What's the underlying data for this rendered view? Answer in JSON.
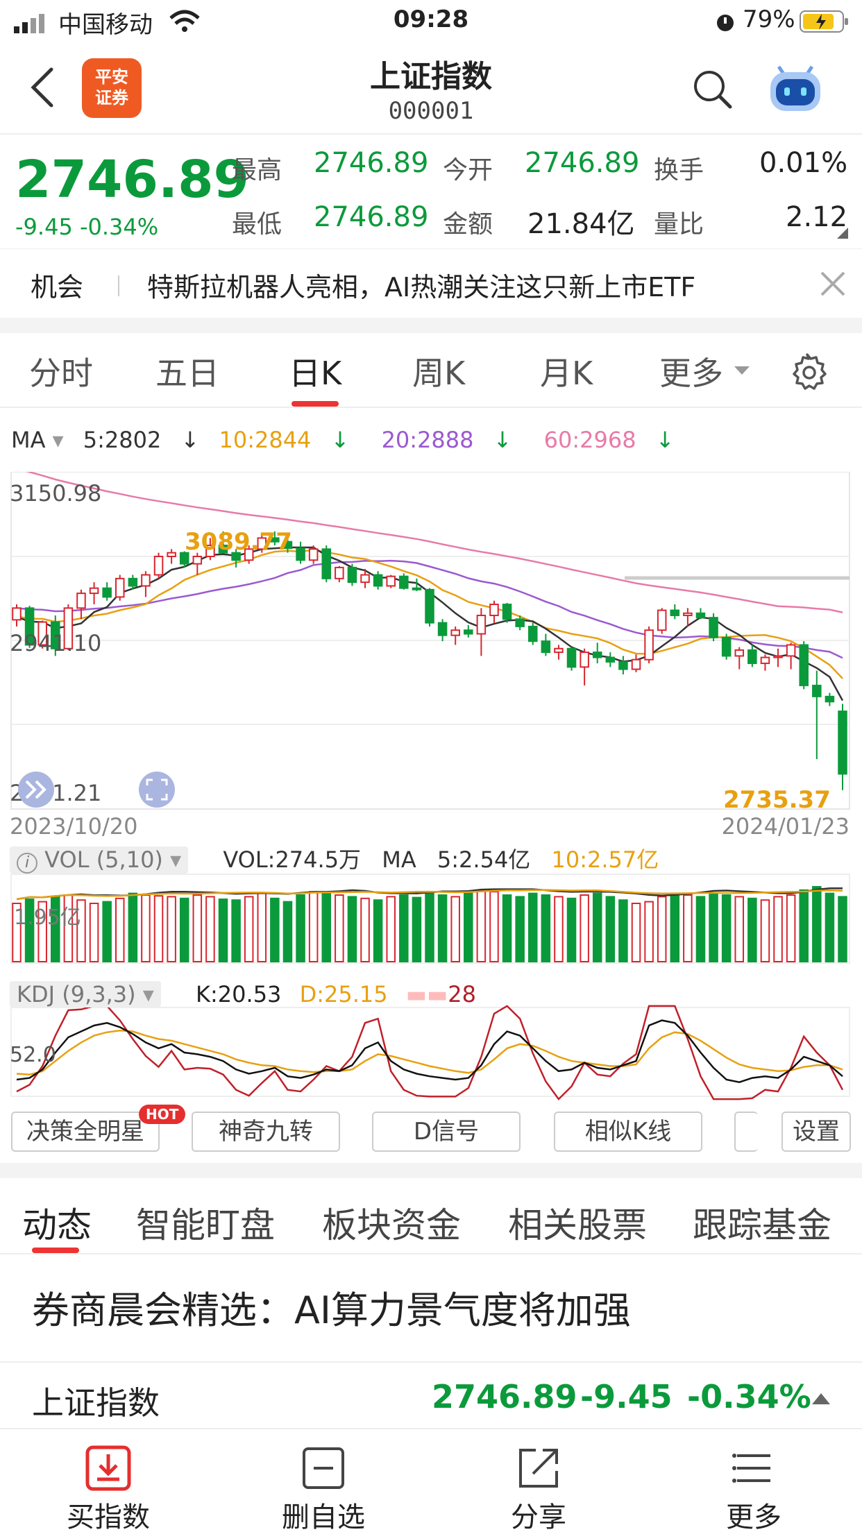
{
  "status_bar": {
    "carrier": "中国移动",
    "time": "09:28",
    "battery": "79%"
  },
  "nav": {
    "logo_line1": "平安",
    "logo_line2": "证券",
    "title": "上证指数",
    "code": "000001"
  },
  "quote": {
    "price": "2746.89",
    "change": "-9.45 -0.34%",
    "stats": [
      {
        "label": "最高",
        "value": "2746.89",
        "color": "green"
      },
      {
        "label": "今开",
        "value": "2746.89",
        "color": "green"
      },
      {
        "label": "换手",
        "value": "0.01%",
        "color": "black"
      },
      {
        "label": "最低",
        "value": "2746.89",
        "color": "green"
      },
      {
        "label": "金额",
        "value": "21.84亿",
        "color": "black"
      },
      {
        "label": "量比",
        "value": "2.12",
        "color": "black"
      }
    ]
  },
  "ticker": {
    "label": "机会",
    "text": "特斯拉机器人亮相，AI热潮关注这只新上市ETF"
  },
  "kline_tabs": [
    "分时",
    "五日",
    "日K",
    "周K",
    "月K",
    "更多"
  ],
  "active_kline_tab": "日K",
  "ma_legend": {
    "label": "MA",
    "ma5": "5:2802",
    "ma10": "10:2844",
    "ma20": "20:2888",
    "ma60": "60:2968"
  },
  "price_axis": {
    "top": "3150.98",
    "mid": "2941.10",
    "low": "2731.21",
    "start_date": "2023/10/20",
    "end_date": "2024/01/23",
    "high_mark": "3089.77",
    "low_mark": "2735.37"
  },
  "volume_legend": {
    "label": "VOL (5,10)",
    "vol": "VOL:274.5万",
    "ma_label": "MA",
    "ma5": "5:2.54亿",
    "ma10": "10:2.57亿",
    "axis": "1.95亿"
  },
  "kdj_legend": {
    "label": "KDJ (9,3,3)",
    "k": "K:20.53",
    "d": "D:25.15",
    "j_tail": "28",
    "axis": "52.0"
  },
  "tools": [
    "决策全明星",
    "神奇九转",
    "D信号",
    "相似K线",
    "设置"
  ],
  "hot_badge": "HOT",
  "info_tabs": [
    "动态",
    "智能盯盘",
    "板块资金",
    "相关股票",
    "跟踪基金"
  ],
  "headline": "券商晨会精选：AI算力景气度将加强",
  "index_row": {
    "name": "上证指数",
    "price": "2746.89",
    "change": "-9.45",
    "pct": "-0.34%"
  },
  "bottom_bar": [
    {
      "label": "买指数",
      "icon": "download-icon"
    },
    {
      "label": "删自选",
      "icon": "minus-box-icon"
    },
    {
      "label": "分享",
      "icon": "share-icon"
    },
    {
      "label": "更多",
      "icon": "list-icon"
    }
  ],
  "colors": {
    "up": "#d8262e",
    "down": "#0b9a3b",
    "ma5": "#333333",
    "ma10": "#e8a010",
    "ma20": "#9b59d0",
    "ma60": "#e77aa8",
    "accent": "#e33333"
  },
  "chart_data": {
    "type": "candlestick",
    "price_range": [
      2731.21,
      3150.98
    ],
    "candles": [
      [
        2969,
        2990,
        2960,
        2985
      ],
      [
        2985,
        2988,
        2931,
        2935
      ],
      [
        2935,
        2968,
        2930,
        2966
      ],
      [
        2966,
        2975,
        2920,
        2930
      ],
      [
        2930,
        2990,
        2928,
        2985
      ],
      [
        2985,
        3010,
        2970,
        3005
      ],
      [
        3005,
        3020,
        2990,
        3012
      ],
      [
        3012,
        3020,
        2995,
        3000
      ],
      [
        3000,
        3030,
        2995,
        3025
      ],
      [
        3025,
        3030,
        3010,
        3015
      ],
      [
        3015,
        3035,
        3000,
        3030
      ],
      [
        3030,
        3060,
        3025,
        3055
      ],
      [
        3055,
        3065,
        3045,
        3060
      ],
      [
        3060,
        3062,
        3040,
        3045
      ],
      [
        3045,
        3060,
        3030,
        3055
      ],
      [
        3055,
        3080,
        3050,
        3070
      ],
      [
        3070,
        3089,
        3060,
        3060
      ],
      [
        3060,
        3065,
        3040,
        3050
      ],
      [
        3050,
        3070,
        3045,
        3065
      ],
      [
        3065,
        3085,
        3060,
        3080
      ],
      [
        3080,
        3089,
        3070,
        3075
      ],
      [
        3075,
        3082,
        3060,
        3066
      ],
      [
        3066,
        3075,
        3045,
        3050
      ],
      [
        3050,
        3070,
        3045,
        3065
      ],
      [
        3065,
        3070,
        3020,
        3025
      ],
      [
        3025,
        3042,
        3020,
        3040
      ],
      [
        3040,
        3045,
        3015,
        3020
      ],
      [
        3020,
        3038,
        3012,
        3030
      ],
      [
        3030,
        3035,
        3010,
        3015
      ],
      [
        3015,
        3030,
        3012,
        3028
      ],
      [
        3028,
        3032,
        3010,
        3012
      ],
      [
        3012,
        3025,
        3008,
        3010
      ],
      [
        3010,
        3012,
        2960,
        2965
      ],
      [
        2965,
        2970,
        2940,
        2948
      ],
      [
        2948,
        2960,
        2935,
        2955
      ],
      [
        2955,
        2962,
        2945,
        2950
      ],
      [
        2950,
        2985,
        2920,
        2975
      ],
      [
        2975,
        2995,
        2965,
        2990
      ],
      [
        2990,
        2992,
        2965,
        2970
      ],
      [
        2970,
        2975,
        2955,
        2960
      ],
      [
        2960,
        2965,
        2935,
        2940
      ],
      [
        2940,
        2950,
        2920,
        2925
      ],
      [
        2925,
        2935,
        2915,
        2930
      ],
      [
        2930,
        2932,
        2900,
        2905
      ],
      [
        2905,
        2930,
        2880,
        2925
      ],
      [
        2925,
        2938,
        2910,
        2918
      ],
      [
        2918,
        2925,
        2905,
        2912
      ],
      [
        2912,
        2920,
        2895,
        2902
      ],
      [
        2902,
        2922,
        2898,
        2915
      ],
      [
        2915,
        2960,
        2910,
        2955
      ],
      [
        2955,
        2985,
        2950,
        2982
      ],
      [
        2982,
        2990,
        2970,
        2975
      ],
      [
        2975,
        2985,
        2960,
        2978
      ],
      [
        2978,
        2985,
        2970,
        2972
      ],
      [
        2972,
        2978,
        2940,
        2945
      ],
      [
        2945,
        2950,
        2915,
        2920
      ],
      [
        2920,
        2932,
        2902,
        2928
      ],
      [
        2928,
        2935,
        2905,
        2910
      ],
      [
        2910,
        2922,
        2900,
        2918
      ],
      [
        2918,
        2930,
        2905,
        2920
      ],
      [
        2920,
        2938,
        2902,
        2935
      ],
      [
        2935,
        2940,
        2875,
        2880
      ],
      [
        2880,
        2900,
        2780,
        2865
      ],
      [
        2865,
        2870,
        2852,
        2858
      ],
      [
        2845,
        2855,
        2738,
        2760
      ]
    ],
    "volume": [
      0.7,
      0.75,
      0.72,
      0.78,
      0.8,
      0.74,
      0.7,
      0.72,
      0.76,
      0.82,
      0.8,
      0.79,
      0.78,
      0.76,
      0.8,
      0.78,
      0.75,
      0.74,
      0.78,
      0.82,
      0.76,
      0.72,
      0.8,
      0.84,
      0.82,
      0.8,
      0.78,
      0.76,
      0.74,
      0.78,
      0.8,
      0.77,
      0.82,
      0.8,
      0.78,
      0.82,
      0.86,
      0.84,
      0.8,
      0.78,
      0.82,
      0.8,
      0.78,
      0.76,
      0.8,
      0.82,
      0.78,
      0.74,
      0.7,
      0.72,
      0.78,
      0.82,
      0.8,
      0.78,
      0.82,
      0.8,
      0.78,
      0.76,
      0.74,
      0.78,
      0.8,
      0.86,
      0.9,
      0.82,
      0.78
    ],
    "kdj_k": [
      18,
      20,
      30,
      50,
      68,
      75,
      82,
      85,
      80,
      72,
      62,
      55,
      60,
      50,
      48,
      45,
      40,
      30,
      25,
      28,
      32,
      22,
      20,
      24,
      30,
      28,
      35,
      55,
      62,
      40,
      30,
      25,
      22,
      20,
      18,
      20,
      35,
      60,
      75,
      70,
      55,
      40,
      28,
      30,
      38,
      32,
      30,
      35,
      40,
      82,
      88,
      85,
      70,
      50,
      32,
      18,
      15,
      20,
      22,
      20,
      30,
      45,
      40,
      35,
      22
    ],
    "kdj_d": [
      25,
      24,
      28,
      40,
      52,
      62,
      70,
      74,
      76,
      75,
      70,
      66,
      64,
      60,
      56,
      52,
      48,
      42,
      38,
      35,
      34,
      30,
      28,
      27,
      28,
      28,
      30,
      40,
      48,
      46,
      42,
      38,
      34,
      31,
      28,
      26,
      30,
      42,
      55,
      60,
      58,
      52,
      45,
      40,
      38,
      36,
      34,
      34,
      36,
      55,
      68,
      74,
      72,
      64,
      54,
      44,
      36,
      32,
      30,
      28,
      29,
      33,
      35,
      35,
      30
    ]
  }
}
